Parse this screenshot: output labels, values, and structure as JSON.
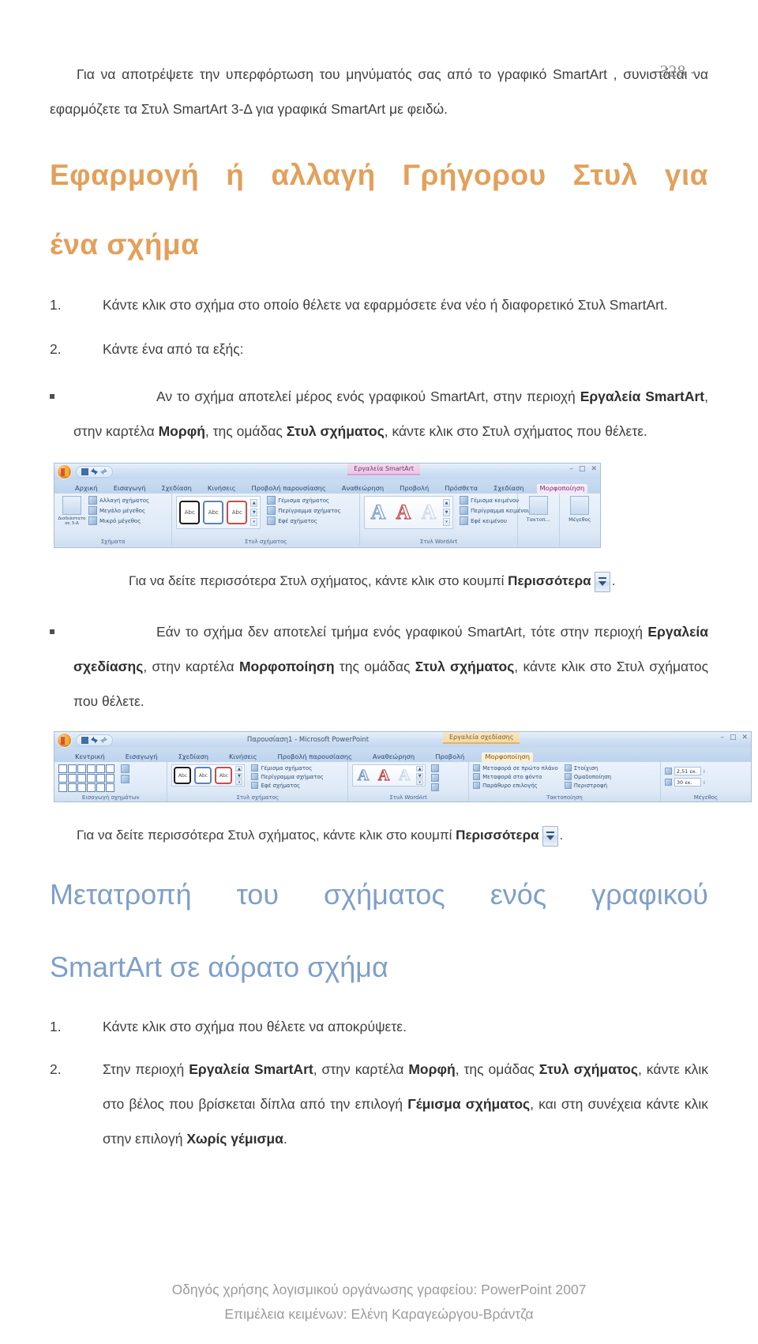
{
  "page": {
    "number_label": "- 328 -",
    "footer_line1": "Οδηγός χρήσης λογισμικού οργάνωσης γραφείου: PowerPoint 2007",
    "footer_line2": "Επιμέλεια κειμένων: Ελένη Καραγεώργου-Βράντζα"
  },
  "colors": {
    "heading_orange": "#e3a05a",
    "heading_blue": "#7e9fcb",
    "body_text": "#3f3f3f",
    "footer_text": "#9b9b9b"
  },
  "intro": {
    "text": "Για να αποτρέψετε την υπερφόρτωση του μηνύματός σας από το γραφικό SmartArt , συνιστάται να εφαρμόζετε τα Στυλ SmartArt 3-Δ για γραφικά SmartArt με φειδώ."
  },
  "section1": {
    "heading_line1": "Εφαρμογή ή αλλαγή Γρήγορου Στυλ για",
    "heading_line2": "ένα σχήμα",
    "step1_marker": "1.",
    "step1_text": "Κάντε κλικ στο σχήμα στο οποίο θέλετε να εφαρμόσετε ένα νέο ή διαφορετικό Στυλ SmartArt.",
    "step2_marker": "2.",
    "step2_text": "Κάντε ένα από τα εξής:",
    "bullet1": {
      "seg1": "Αν το σχήμα αποτελεί μέρος ενός γραφικού SmartArt, στην περιοχή ",
      "bold1": "Εργαλεία SmartArt",
      "seg2": ", στην καρτέλα ",
      "bold2": "Μορφή",
      "seg3": ", της ομάδας ",
      "bold3": "Στυλ σχήματος",
      "seg4": ", κάντε κλικ στο Στυλ σχήματος που θέλετε."
    },
    "note1": {
      "seg1": "Για να δείτε περισσότερα Στυλ σχήματος, κάντε κλικ στο κουμπί ",
      "bold1": "Περισσότερα",
      "seg2": "."
    },
    "bullet2": {
      "seg1": "Εάν το σχήμα δεν αποτελεί τμήμα ενός γραφικού SmartArt, τότε στην περιοχή ",
      "bold1": "Εργαλεία σχεδίασης",
      "seg2": ", στην καρτέλα ",
      "bold2": "Μορφοποίηση",
      "seg3": " της ομάδας ",
      "bold3": "Στυλ σχήματος",
      "seg4": ", κάντε κλικ στο Στυλ σχήματος που θέλετε."
    },
    "note2": {
      "seg1": "Για να δείτε περισσότερα Στυλ σχήματος, κάντε κλικ στο κουμπί ",
      "bold1": "Περισσότερα",
      "seg2": "."
    }
  },
  "section2": {
    "heading_line1": "Μετατροπή του σχήματος ενός γραφικού",
    "heading_line2": "SmartArt σε αόρατο σχήμα",
    "step1_marker": "1.",
    "step1_text": "Κάντε κλικ στο σχήμα που θέλετε να αποκρύψετε.",
    "step2_marker": "2.",
    "step2": {
      "seg1": "Στην περιοχή ",
      "bold1": "Εργαλεία SmartArt",
      "seg2": ", στην καρτέλα ",
      "bold2": "Μορφή",
      "seg3": ", της ομάδας ",
      "bold3": "Στυλ σχήματος",
      "seg4": ", κάντε κλικ στο βέλος που βρίσκεται δίπλα από την επιλογή ",
      "bold4": "Γέμισμα σχήματος",
      "seg5": ", και στη συνέχεια κάντε κλικ στην επιλογή ",
      "bold5": "Χωρίς γέμισμα",
      "seg6": "."
    }
  },
  "ribbon1": {
    "context_tab": "Εργαλεία SmartArt",
    "tabs": [
      "Αρχική",
      "Εισαγωγή",
      "Σχεδίαση",
      "Κινήσεις",
      "Προβολή παρουσίασης",
      "Αναθεώρηση",
      "Προβολή",
      "Πρόσθετα",
      "Σχεδίαση",
      "Μορφοποίηση"
    ],
    "active_tab": "Μορφοποίηση",
    "group_shapes": {
      "label": "Σχήματα",
      "commands": [
        "Αλλαγή σχήματος",
        "Μεγάλο μέγεθος",
        "Μικρό μέγεθος"
      ],
      "extra_label": "Δισδιάστατο σε 3-Δ"
    },
    "group_shape_styles": {
      "label": "Στυλ σχήματος",
      "thumbs": [
        "Abc",
        "Abc",
        "Abc"
      ],
      "commands": [
        "Γέμισμα σχήματος",
        "Περίγραμμα σχήματος",
        "Εφέ σχήματος"
      ]
    },
    "group_wordart": {
      "label": "Στυλ WordArt",
      "thumbs": [
        "A",
        "A",
        "A"
      ],
      "commands": [
        "Γέμισμα κειμένου",
        "Περίγραμμα κειμένου",
        "Εφέ κειμένου"
      ]
    },
    "group_arrange": {
      "label": "Τακτοποίηση",
      "tile": "Τακτοπ..."
    },
    "group_size": {
      "label": "Μέγεθος",
      "tile": "Μέγεθος"
    },
    "window_buttons": [
      "–",
      "□",
      "✕"
    ]
  },
  "ribbon2": {
    "document_title": "Παρουσίαση1 - Microsoft PowerPoint",
    "context_tab": "Εργαλεία σχεδίασης",
    "tabs": [
      "Κεντρική",
      "Εισαγωγή",
      "Σχεδίαση",
      "Κινήσεις",
      "Προβολή παρουσίασης",
      "Αναθεώρηση",
      "Προβολή",
      "Μορφοποίηση"
    ],
    "active_tab": "Μορφοποίηση",
    "group_insert_shapes": {
      "label": "Εισαγωγή σχημάτων"
    },
    "group_shape_styles": {
      "label": "Στυλ σχήματος",
      "thumbs": [
        "Abc",
        "Abc",
        "Abc"
      ],
      "commands": [
        "Γέμισμα σχήματος",
        "Περίγραμμα σχήματος",
        "Εφέ σχήματος"
      ]
    },
    "group_wordart": {
      "label": "Στυλ WordArt",
      "thumbs": [
        "A",
        "A",
        "A"
      ]
    },
    "group_arrange": {
      "label": "Τακτοποίηση",
      "commands": [
        "Μεταφορά σε πρώτο πλάνο",
        "Μεταφορά στο φόντο",
        "Παράθυρο επιλογής",
        "Στοίχιση",
        "Ομαδοποίηση",
        "Περιστροφή"
      ]
    },
    "group_size": {
      "label": "Μέγεθος",
      "height_value": "2,51 εκ.",
      "width_value": "30 εκ."
    },
    "window_buttons": [
      "–",
      "□",
      "✕"
    ]
  }
}
